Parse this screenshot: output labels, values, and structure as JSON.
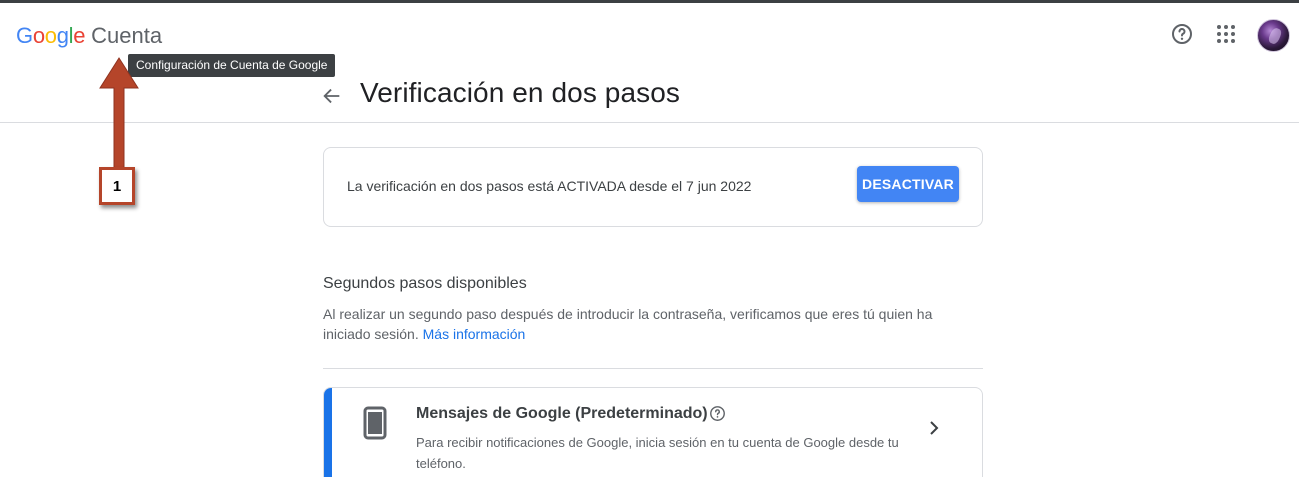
{
  "header": {
    "logo_letters": [
      "G",
      "o",
      "o",
      "g",
      "l",
      "e"
    ],
    "logo_colors": [
      "#4285f4",
      "#ea4335",
      "#fbbc05",
      "#4285f4",
      "#34a853",
      "#ea4335"
    ],
    "product": "Cuenta",
    "tooltip": "Configuración de Cuenta de Google",
    "icons": [
      "help-icon",
      "apps-grid-icon",
      "avatar"
    ]
  },
  "page": {
    "title": "Verificación en dos pasos",
    "back_icon": "arrow-back-icon"
  },
  "status_card": {
    "text": "La verificación en dos pasos está ACTIVADA desde el 7 jun 2022",
    "button": "DESACTIVAR",
    "button_color": "#4285f4"
  },
  "section": {
    "title": "Segundos pasos disponibles",
    "description": "Al realizar un segundo paso después de introducir la contraseña, verificamos que eres tú quien ha iniciado sesión.",
    "link": "Más información",
    "link_color": "#1a73e8"
  },
  "option": {
    "title": "Mensajes de Google (Predeterminado)",
    "description": "Para recibir notificaciones de Google, inicia sesión en tu cuenta de Google desde tu teléfono.",
    "icon": "phone-icon",
    "accent_color": "#1a73e8"
  },
  "annotation": {
    "number": "1",
    "color": "#b5452a"
  }
}
